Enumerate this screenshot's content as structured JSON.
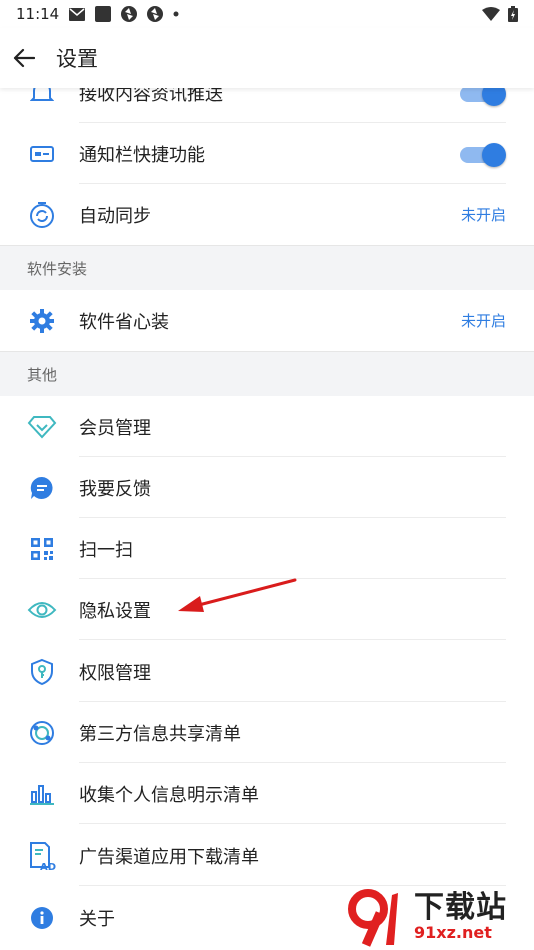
{
  "status_bar": {
    "time": "11:14"
  },
  "app_bar": {
    "title": "设置"
  },
  "rows": {
    "push": {
      "label": "接收内容资讯推送"
    },
    "notif": {
      "label": "通知栏快捷功能"
    },
    "sync": {
      "label": "自动同步",
      "value": "未开启"
    },
    "install": {
      "label": "软件省心装",
      "value": "未开启"
    },
    "vip": {
      "label": "会员管理"
    },
    "feedback": {
      "label": "我要反馈"
    },
    "scan": {
      "label": "扫一扫"
    },
    "privacy": {
      "label": "隐私设置"
    },
    "permission": {
      "label": "权限管理"
    },
    "third_party": {
      "label": "第三方信息共享清单"
    },
    "collect": {
      "label": "收集个人信息明示清单"
    },
    "ad": {
      "label": "广告渠道应用下载清单"
    },
    "about": {
      "label": "关于"
    }
  },
  "sections": {
    "install": "软件安装",
    "other": "其他"
  },
  "toggles": {
    "push": true,
    "notif": true
  },
  "watermark": {
    "cn": "下载站",
    "url": "91xz.net"
  },
  "colors": {
    "accent": "#2f7de1",
    "arrow": "#d91c1c"
  }
}
